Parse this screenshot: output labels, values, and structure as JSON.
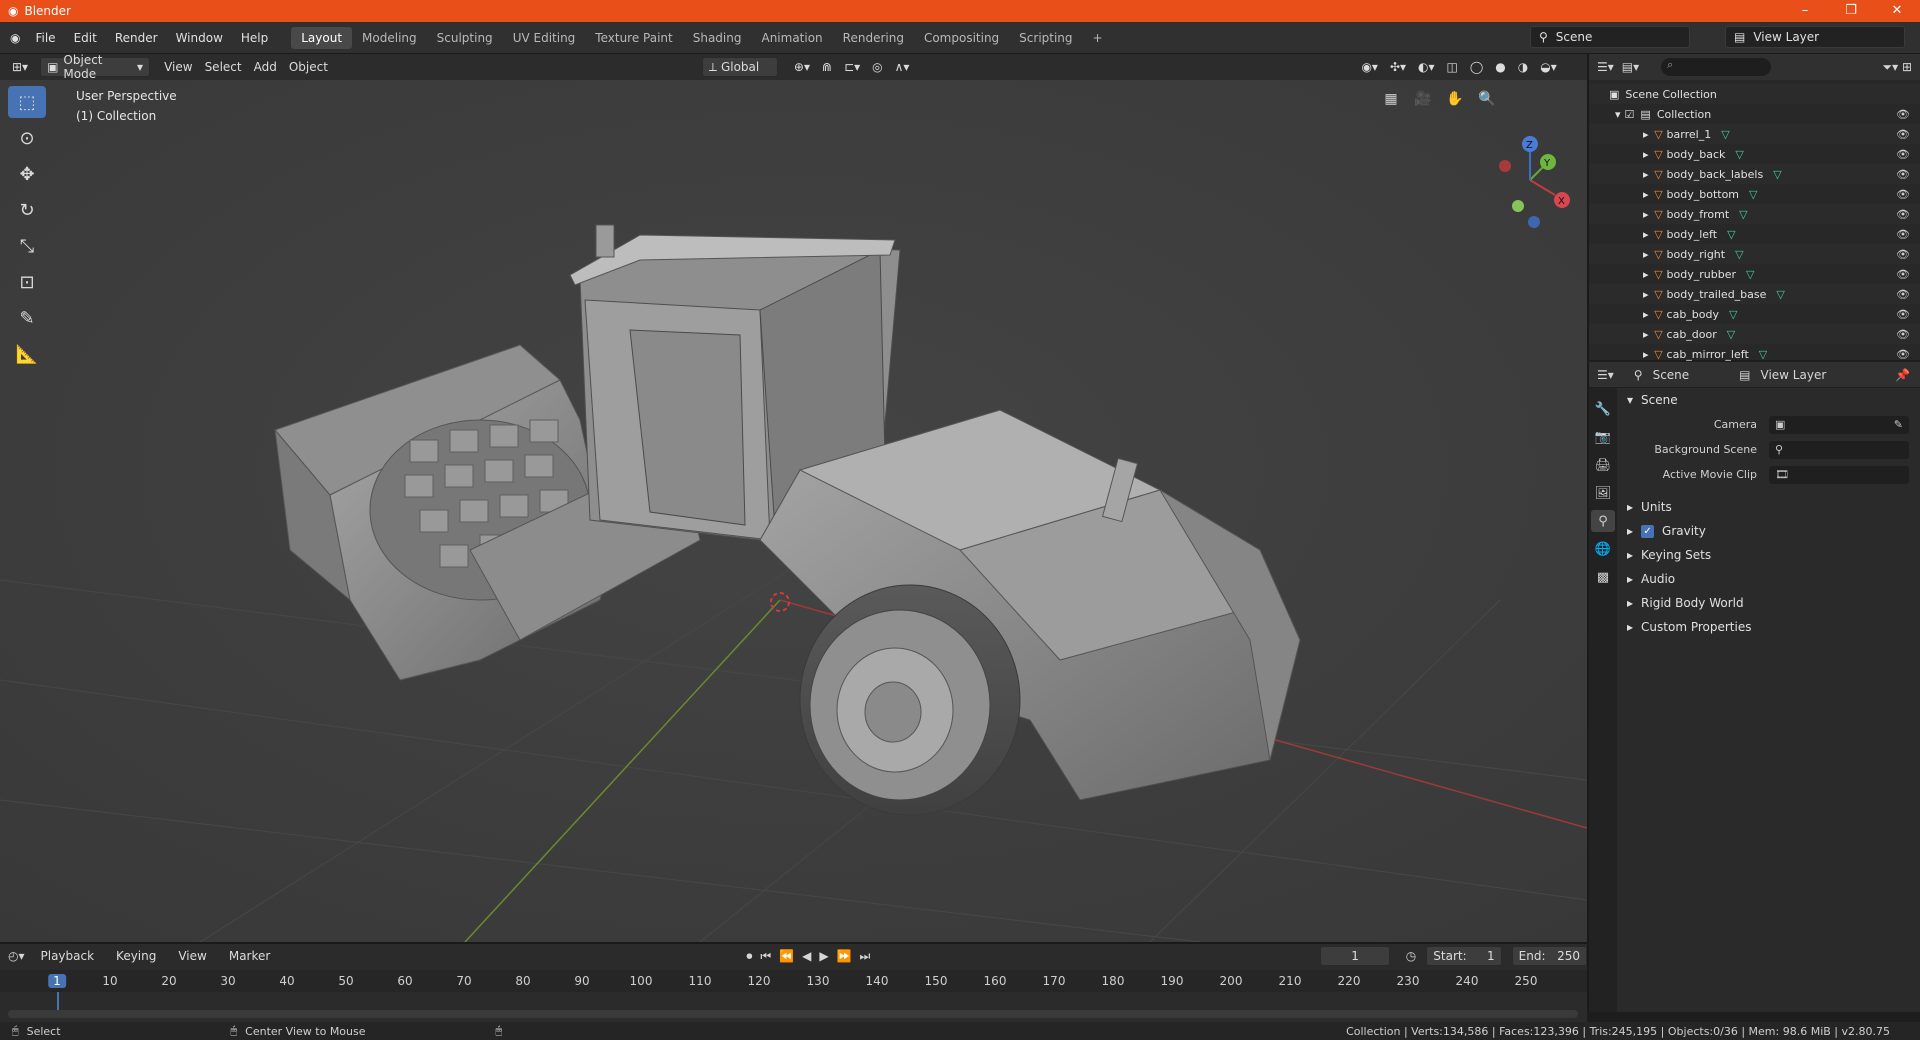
{
  "window": {
    "title": "Blender",
    "controls": [
      "–",
      "❐",
      "✕"
    ]
  },
  "menu": [
    "File",
    "Edit",
    "Render",
    "Window",
    "Help"
  ],
  "workspaces": [
    "Layout",
    "Modeling",
    "Sculpting",
    "UV Editing",
    "Texture Paint",
    "Shading",
    "Animation",
    "Rendering",
    "Compositing",
    "Scripting",
    "+"
  ],
  "active_workspace": "Layout",
  "scene_name": "Scene",
  "view_layer_name": "View Layer",
  "viewport_header": {
    "mode": "Object Mode",
    "menus": [
      "View",
      "Select",
      "Add",
      "Object"
    ],
    "transform_orientation": "Global"
  },
  "viewport_overlay": {
    "line1": "User Perspective",
    "line2": "(1) Collection"
  },
  "gizmo": {
    "x": "X",
    "y": "Y",
    "z": "Z"
  },
  "outliner": {
    "root": "Scene Collection",
    "collection": "Collection",
    "objects": [
      "barrel_1",
      "body_back",
      "body_back_labels",
      "body_bottom",
      "body_fromt",
      "body_left",
      "body_right",
      "body_rubber",
      "body_trailed_base",
      "cab_body",
      "cab_door",
      "cab_mirror_left"
    ]
  },
  "properties": {
    "header_scene": "Scene",
    "header_view_layer": "View Layer",
    "section": "Scene",
    "fields": [
      {
        "label": "Camera",
        "value": ""
      },
      {
        "label": "Background Scene",
        "value": ""
      },
      {
        "label": "Active Movie Clip",
        "value": ""
      }
    ],
    "subsections": [
      "Units",
      "Gravity",
      "Keying Sets",
      "Audio",
      "Rigid Body World",
      "Custom Properties"
    ],
    "gravity_checked": true
  },
  "timeline": {
    "menus": [
      "Playback",
      "Keying",
      "View",
      "Marker"
    ],
    "current_frame": "1",
    "start_label": "Start:",
    "start": "1",
    "end_label": "End:",
    "end": "250",
    "ruler": [
      "1",
      "10",
      "20",
      "30",
      "40",
      "50",
      "60",
      "70",
      "80",
      "90",
      "100",
      "110",
      "120",
      "130",
      "140",
      "150",
      "160",
      "170",
      "180",
      "190",
      "200",
      "210",
      "220",
      "230",
      "240",
      "250"
    ]
  },
  "statusbar": {
    "left1": "Select",
    "left2": "Center View to Mouse",
    "right": "Collection | Verts:134,586 | Faces:123,396 | Tris:245,195 | Objects:0/36 | Mem: 98.6 MiB | v2.80.75"
  }
}
